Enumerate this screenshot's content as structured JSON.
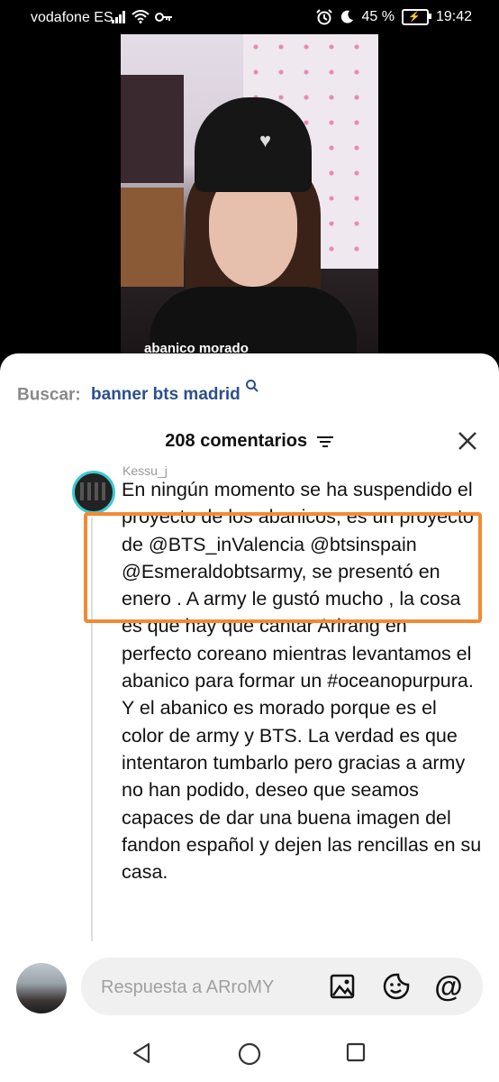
{
  "status": {
    "carrier": "vodafone ES",
    "battery": "45 %",
    "time": "19:42"
  },
  "video": {
    "caption": "abanico morado"
  },
  "search": {
    "label": "Buscar:",
    "query": "banner bts madrid"
  },
  "comments_header": {
    "count": "208 comentarios"
  },
  "comment": {
    "username": "Kessu_j",
    "text": "En ningún momento se ha suspendido el proyecto de los abanicos, es un proyecto de @BTS_inValencia @btsinspain @Esmeraldobtsarmy, se presentó en enero . A army le gustó mucho , la cosa es que hay que cantar Arirang en perfecto coreano mientras levantamos el abanico para formar un #oceanopurpura.\nY el abanico es morado porque es el color de army y BTS. La verdad es que intentaron tumbarlo pero gracias a army no han podido, deseo que seamos capaces de dar una buena imagen del fandon español y dejen las rencillas en su casa."
  },
  "reply": {
    "placeholder": "Respuesta a ARroMY"
  },
  "colors": {
    "highlight": "#f28a33",
    "link": "#2c4f8c",
    "avatar_ring": "#3cc9d3"
  },
  "icons": [
    "signal-icon",
    "wifi-icon",
    "key-icon",
    "alarm-icon",
    "moon-icon",
    "battery-icon",
    "search-icon",
    "filter-icon",
    "close-icon",
    "image-icon",
    "sticker-icon",
    "mention-icon",
    "back-icon",
    "home-icon",
    "recents-icon"
  ]
}
